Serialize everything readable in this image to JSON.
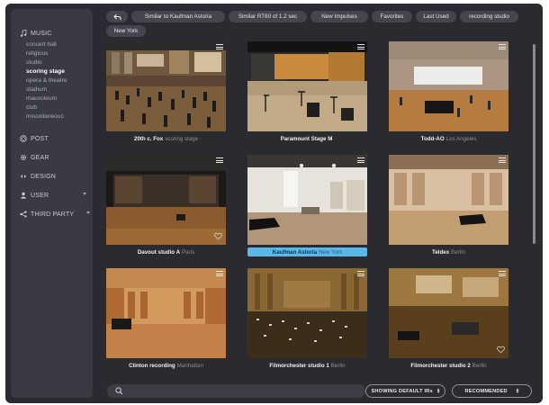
{
  "sidebar": {
    "categories": [
      {
        "label": "MUSIC",
        "icon": "music-note-icon"
      },
      {
        "label": "POST",
        "icon": "film-reel-icon"
      },
      {
        "label": "GEAR",
        "icon": "gear-icon"
      },
      {
        "label": "DESIGN",
        "icon": "design-icon"
      },
      {
        "label": "USER",
        "icon": "user-icon"
      },
      {
        "label": "THIRD PARTY",
        "icon": "share-icon"
      }
    ],
    "music_items": [
      "concert hall",
      "religious",
      "studio",
      "scoring stage",
      "opera & theatre",
      "stadium",
      "mausoleum",
      "club",
      "miscellaneous"
    ],
    "active_item": "scoring stage"
  },
  "tags": [
    "Similar to Kaufman Astoria",
    "Similar RT60 of 1.2 sec",
    "New Impulses",
    "Favorites",
    "Last Used",
    "recording studio",
    "New York"
  ],
  "cards": [
    {
      "name": "20th c. Fox",
      "location": "scoring stage"
    },
    {
      "name": "Paramount Stage M",
      "location": ""
    },
    {
      "name": "Todd-AO",
      "location": "Los Angeles"
    },
    {
      "name": "Davout studio A",
      "location": "Paris"
    },
    {
      "name": "Kaufman Astoria",
      "location": "New York"
    },
    {
      "name": "Teldex",
      "location": "Berlin"
    },
    {
      "name": "Clinton recording",
      "location": "Manhattan"
    },
    {
      "name": "Filmorchester studio 1",
      "location": "Berlin"
    },
    {
      "name": "Filmorchester studio 2",
      "location": "Berlin"
    }
  ],
  "selected_card": "Kaufman Astoria",
  "bottom": {
    "search_placeholder": "",
    "filter_label": "SHOWING DEFAULT IRs",
    "sort_label": "RECOMMENDED"
  },
  "colors": {
    "accent": "#5ab8e8",
    "background": "#2a2b30",
    "sidebar": "#3a3b42"
  }
}
